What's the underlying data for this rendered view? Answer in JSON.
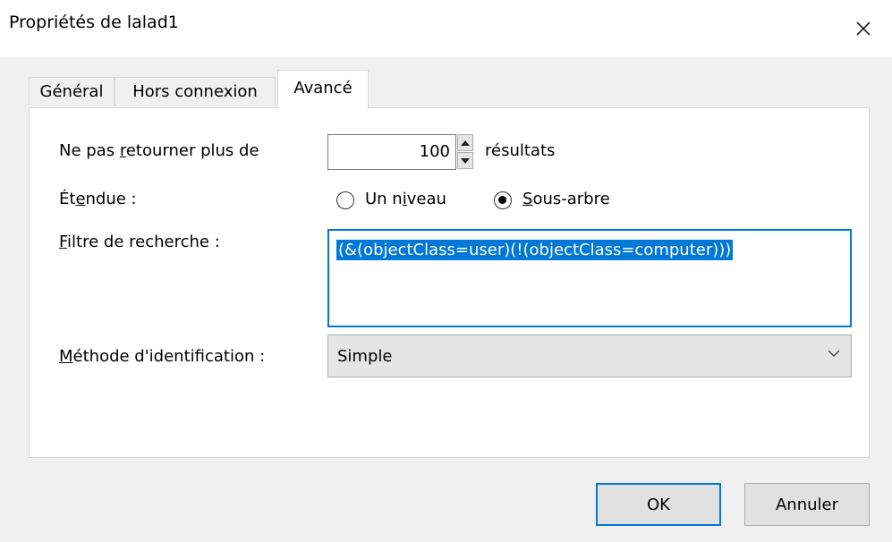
{
  "window": {
    "title": "Propriétés de lalad1",
    "close_icon": "close-icon"
  },
  "tabs": [
    {
      "label": "Général",
      "active": false
    },
    {
      "label": "Hors connexion",
      "active": false
    },
    {
      "label": "Avancé",
      "active": true
    }
  ],
  "advanced": {
    "max_results": {
      "label_pre": "Ne pas ",
      "label_accel": "r",
      "label_post": "etourner plus de",
      "value": "100",
      "suffix": "résultats"
    },
    "scope": {
      "label_pre": "Ét",
      "label_accel": "e",
      "label_post": "ndue :",
      "options": [
        {
          "pre": "Un n",
          "accel": "i",
          "post": "veau",
          "checked": false
        },
        {
          "pre": "",
          "accel": "S",
          "post": "ous-arbre",
          "checked": true
        }
      ]
    },
    "search_filter": {
      "label_pre": "",
      "label_accel": "F",
      "label_post": "iltre de recherche :",
      "value": "(&(objectClass=user)(!(objectClass=computer)))"
    },
    "auth_method": {
      "label_pre": "",
      "label_accel": "M",
      "label_post": "éthode d'identification :",
      "value": "Simple"
    }
  },
  "buttons": {
    "ok": "OK",
    "cancel": "Annuler"
  },
  "colors": {
    "accent": "#0078d7",
    "window_bg": "#f0f0f0",
    "panel_bg": "#ffffff"
  }
}
